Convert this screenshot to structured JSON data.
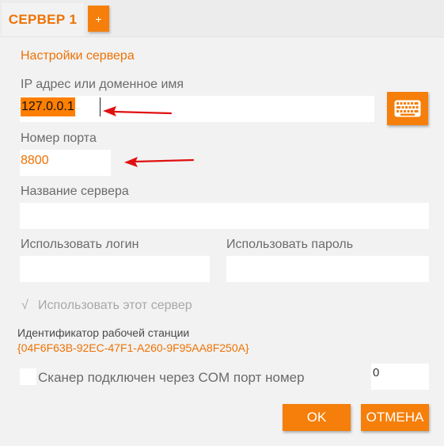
{
  "tabs": {
    "active_label": "СЕРВЕР 1",
    "add_label": "+"
  },
  "section_title": "Настройки сервера",
  "ip": {
    "label": "IP адрес или доменное имя",
    "value": "127.0.0.1"
  },
  "keyboard": {
    "icon": "keyboard-icon"
  },
  "port": {
    "label": "Номер порта",
    "value": "8800"
  },
  "server_name": {
    "label": "Название сервера",
    "value": ""
  },
  "login": {
    "label": "Использовать логин",
    "value": ""
  },
  "password": {
    "label": "Использовать пароль",
    "value": ""
  },
  "use_server": {
    "label": "Использовать этот сервер",
    "check_glyph": "√",
    "checked": true
  },
  "workstation": {
    "label": "Идентификатор рабочей станции",
    "value": "{04F6F63B-92EC-47F1-A260-9F95AA8F250A}"
  },
  "com_port": {
    "label": "Сканер подключен через COM порт номер",
    "checked": false,
    "value": "0"
  },
  "buttons": {
    "ok": "OK",
    "cancel": "ОТМЕНА"
  },
  "colors": {
    "accent": "#f57f0a",
    "accent_text": "#ee7203",
    "arrow": "#e01010",
    "background": "#f2f2f2"
  }
}
